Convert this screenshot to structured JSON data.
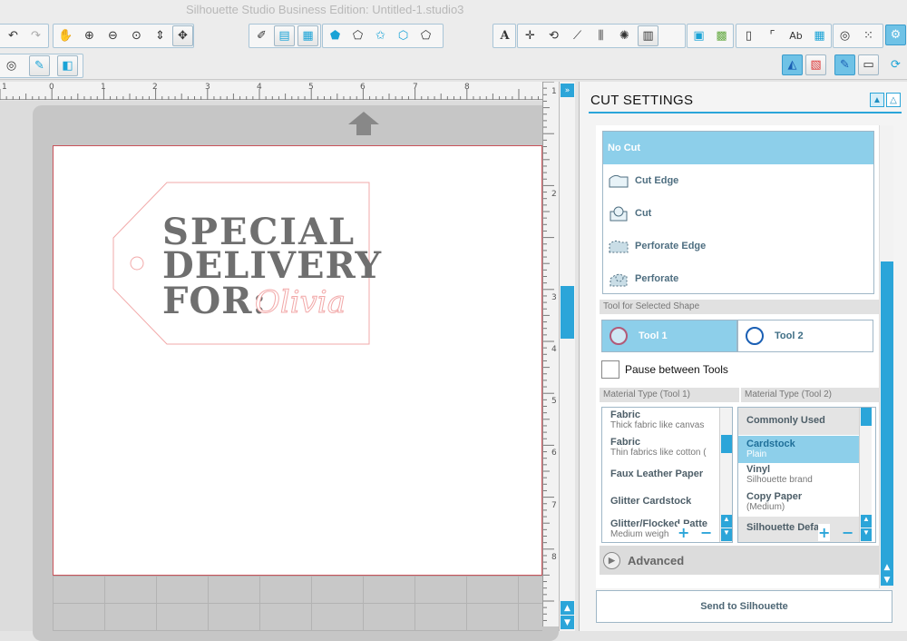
{
  "window": {
    "title": "Silhouette Studio Business Edition: Untitled-1.studio3"
  },
  "toolbar1": {
    "left_icons": [
      "undo-icon",
      "redo-icon",
      "pan-hand-icon",
      "zoom-in-icon",
      "zoom-out-icon",
      "zoom-select-icon",
      "zoom-drag-icon",
      "fit-to-page-icon"
    ],
    "mid_icons": [
      "eraser-icon",
      "fill-panel-icon",
      "pattern-icon",
      "pentagon-fill-icon",
      "pentagon-outline-icon",
      "star-icon",
      "polygon-icon",
      "smooth-polygon-icon",
      "color-wheel-icon",
      "line-color-icon",
      "line-style-icon",
      "text-style-icon",
      "transform-icon",
      "replicate-icon",
      "knife-icon",
      "align-icon",
      "offset-icon",
      "trace-icon",
      "library-icon",
      "store-icon",
      "page-setup-icon",
      "registration-icon",
      "text-tool-icon",
      "grid-icon",
      "spiral-icon",
      "dots-icon",
      "settings-icon"
    ],
    "text_tool_label": "A",
    "font_button_label": "Ab"
  },
  "toolbar2": {
    "left_icons": [
      "target-icon",
      "pen-icon",
      "page-icon"
    ],
    "right_icons": [
      "design-mode-icon",
      "send-mode-icon",
      "cut-settings-icon",
      "send-panel-icon",
      "refresh-icon"
    ]
  },
  "ruler": {
    "h_labels": [
      "1",
      "0",
      "1",
      "2",
      "3",
      "4",
      "5",
      "6",
      "7",
      "8"
    ],
    "v_labels": [
      "1",
      "2",
      "3",
      "4",
      "5",
      "6",
      "7",
      "8"
    ]
  },
  "design": {
    "line1": "SPECIAL",
    "line2": "DELIVERY",
    "line3": "FOR:",
    "script_name": "Olivia"
  },
  "cut_settings": {
    "title": "CUT SETTINGS",
    "cut_styles": [
      {
        "label": "No Cut",
        "icon": "",
        "selected": true
      },
      {
        "label": "Cut Edge",
        "icon": "cut-edge-icon",
        "selected": false
      },
      {
        "label": "Cut",
        "icon": "cut-icon",
        "selected": false
      },
      {
        "label": "Perforate Edge",
        "icon": "perforate-edge-icon",
        "selected": false
      },
      {
        "label": "Perforate",
        "icon": "perforate-icon",
        "selected": false
      }
    ],
    "tool_section_label": "Tool for Selected Shape",
    "tools": [
      {
        "label": "Tool 1",
        "selected": true,
        "color": "#b25a78"
      },
      {
        "label": "Tool 2",
        "selected": false,
        "color": "#1a5fb4"
      }
    ],
    "pause_label": "Pause between Tools",
    "pause_checked": false,
    "material_tool1_label": "Material Type (Tool 1)",
    "material_tool2_label": "Material Type (Tool 2)",
    "materials_tool1": [
      {
        "name": "Fabric",
        "desc": "Thick fabric like canvas"
      },
      {
        "name": "Fabric",
        "desc": "Thin fabrics like cotton ("
      },
      {
        "name": "Faux Leather Paper",
        "desc": ""
      },
      {
        "name": "Glitter Cardstock",
        "desc": ""
      },
      {
        "name": "Glitter/Flocked Patte",
        "desc": "Medium weigh"
      }
    ],
    "materials_tool2": [
      {
        "name": "Commonly Used",
        "desc": "",
        "type": "header"
      },
      {
        "name": "Cardstock",
        "desc": "Plain",
        "type": "selected"
      },
      {
        "name": "Vinyl",
        "desc": "Silhouette brand",
        "type": "normal"
      },
      {
        "name": "Copy Paper",
        "desc": "(Medium)",
        "type": "normal"
      },
      {
        "name": "Silhouette Defa",
        "desc": "",
        "type": "header"
      }
    ],
    "plus": "+",
    "minus": "−",
    "advanced_label": "Advanced",
    "send_label": "Send to Silhouette"
  },
  "colors": {
    "accent": "#2ba5d9",
    "selection": "#8dcfea",
    "cut_line": "#f2a9a9"
  }
}
